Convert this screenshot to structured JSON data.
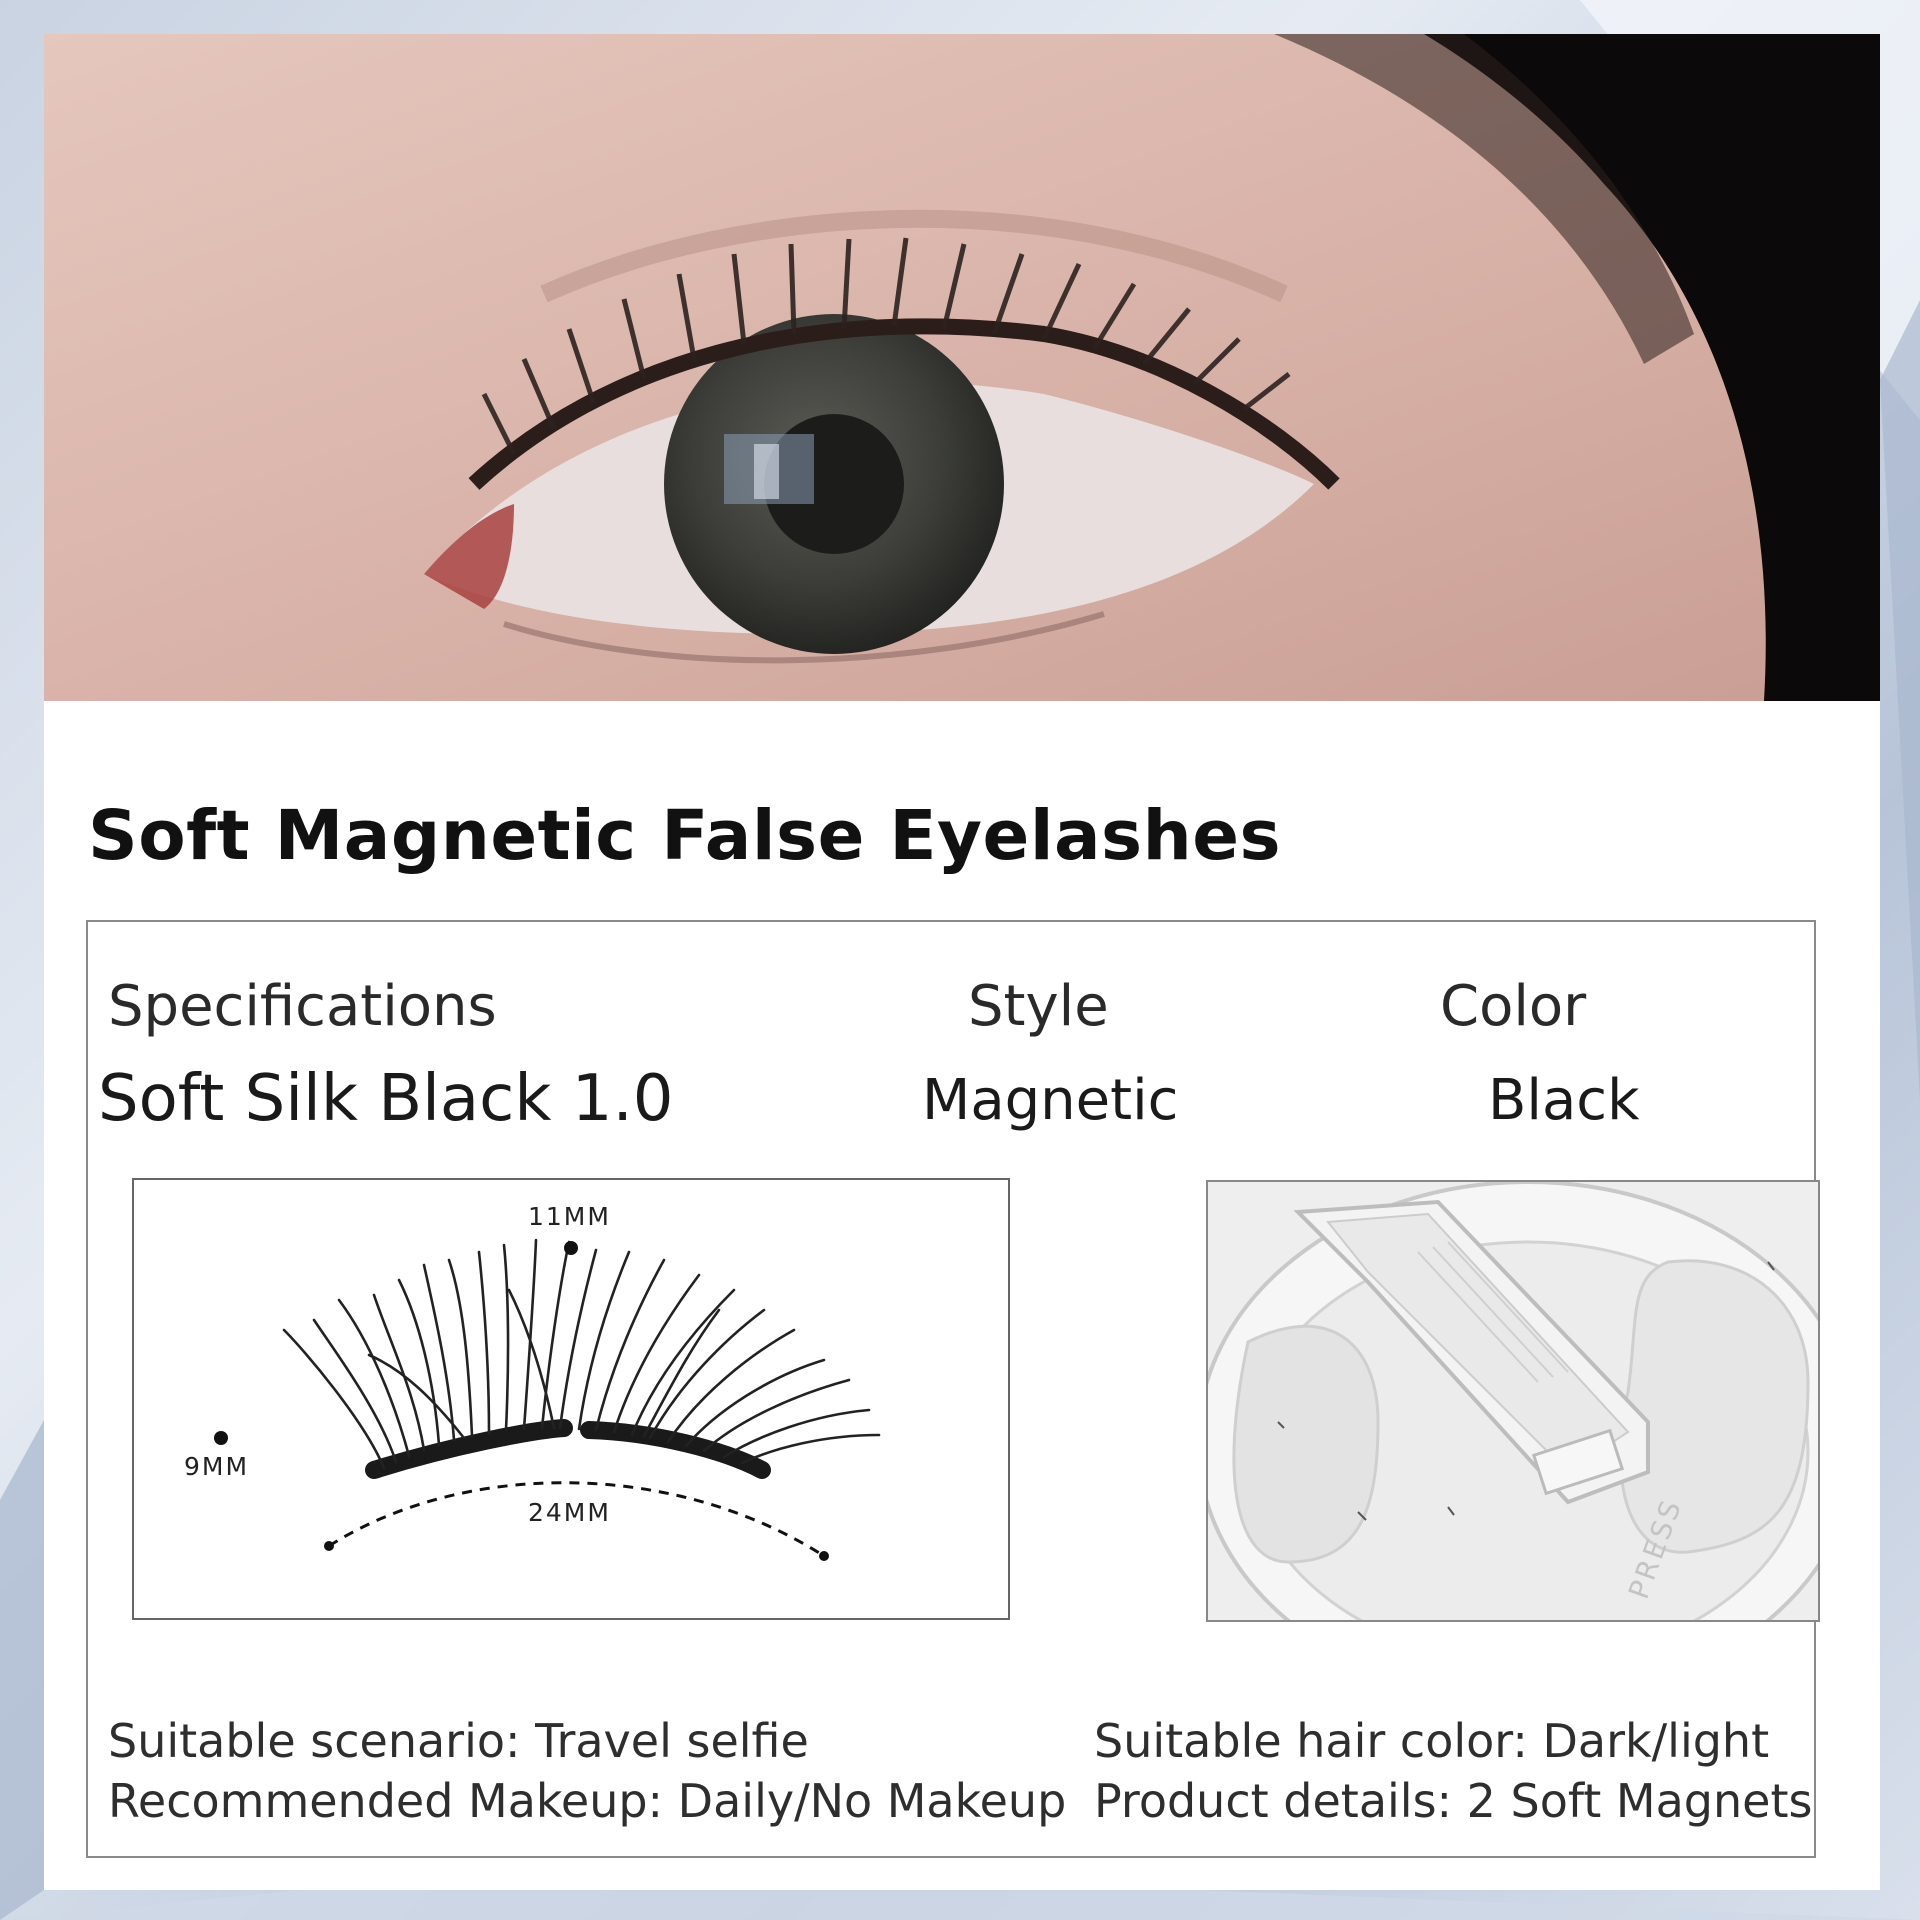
{
  "product": {
    "title": "Soft Magnetic False Eyelashes"
  },
  "specs": {
    "headers": {
      "specifications": "Specifications",
      "style": "Style",
      "color": "Color"
    },
    "values": {
      "specifications": "Soft Silk Black 1.0",
      "style": "Magnetic",
      "color": "Black"
    }
  },
  "lash_diagram": {
    "top_length": "11MM",
    "side_length": "9MM",
    "width": "24MM"
  },
  "applicator_image": {
    "engraved_text": "PRESS"
  },
  "details": {
    "scenario": "Suitable scenario: Travel selfie",
    "makeup": "Recommended Makeup: Daily/No Makeup",
    "hair_color": "Suitable hair color: Dark/light",
    "product_details": "Product details: 2 Soft Magnets"
  },
  "colors": {
    "card_bg": "#ffffff",
    "title_text": "#111111",
    "page_bg": "#c9d3e2",
    "skin": "#d9b7ae",
    "iris": "#3f403b"
  }
}
